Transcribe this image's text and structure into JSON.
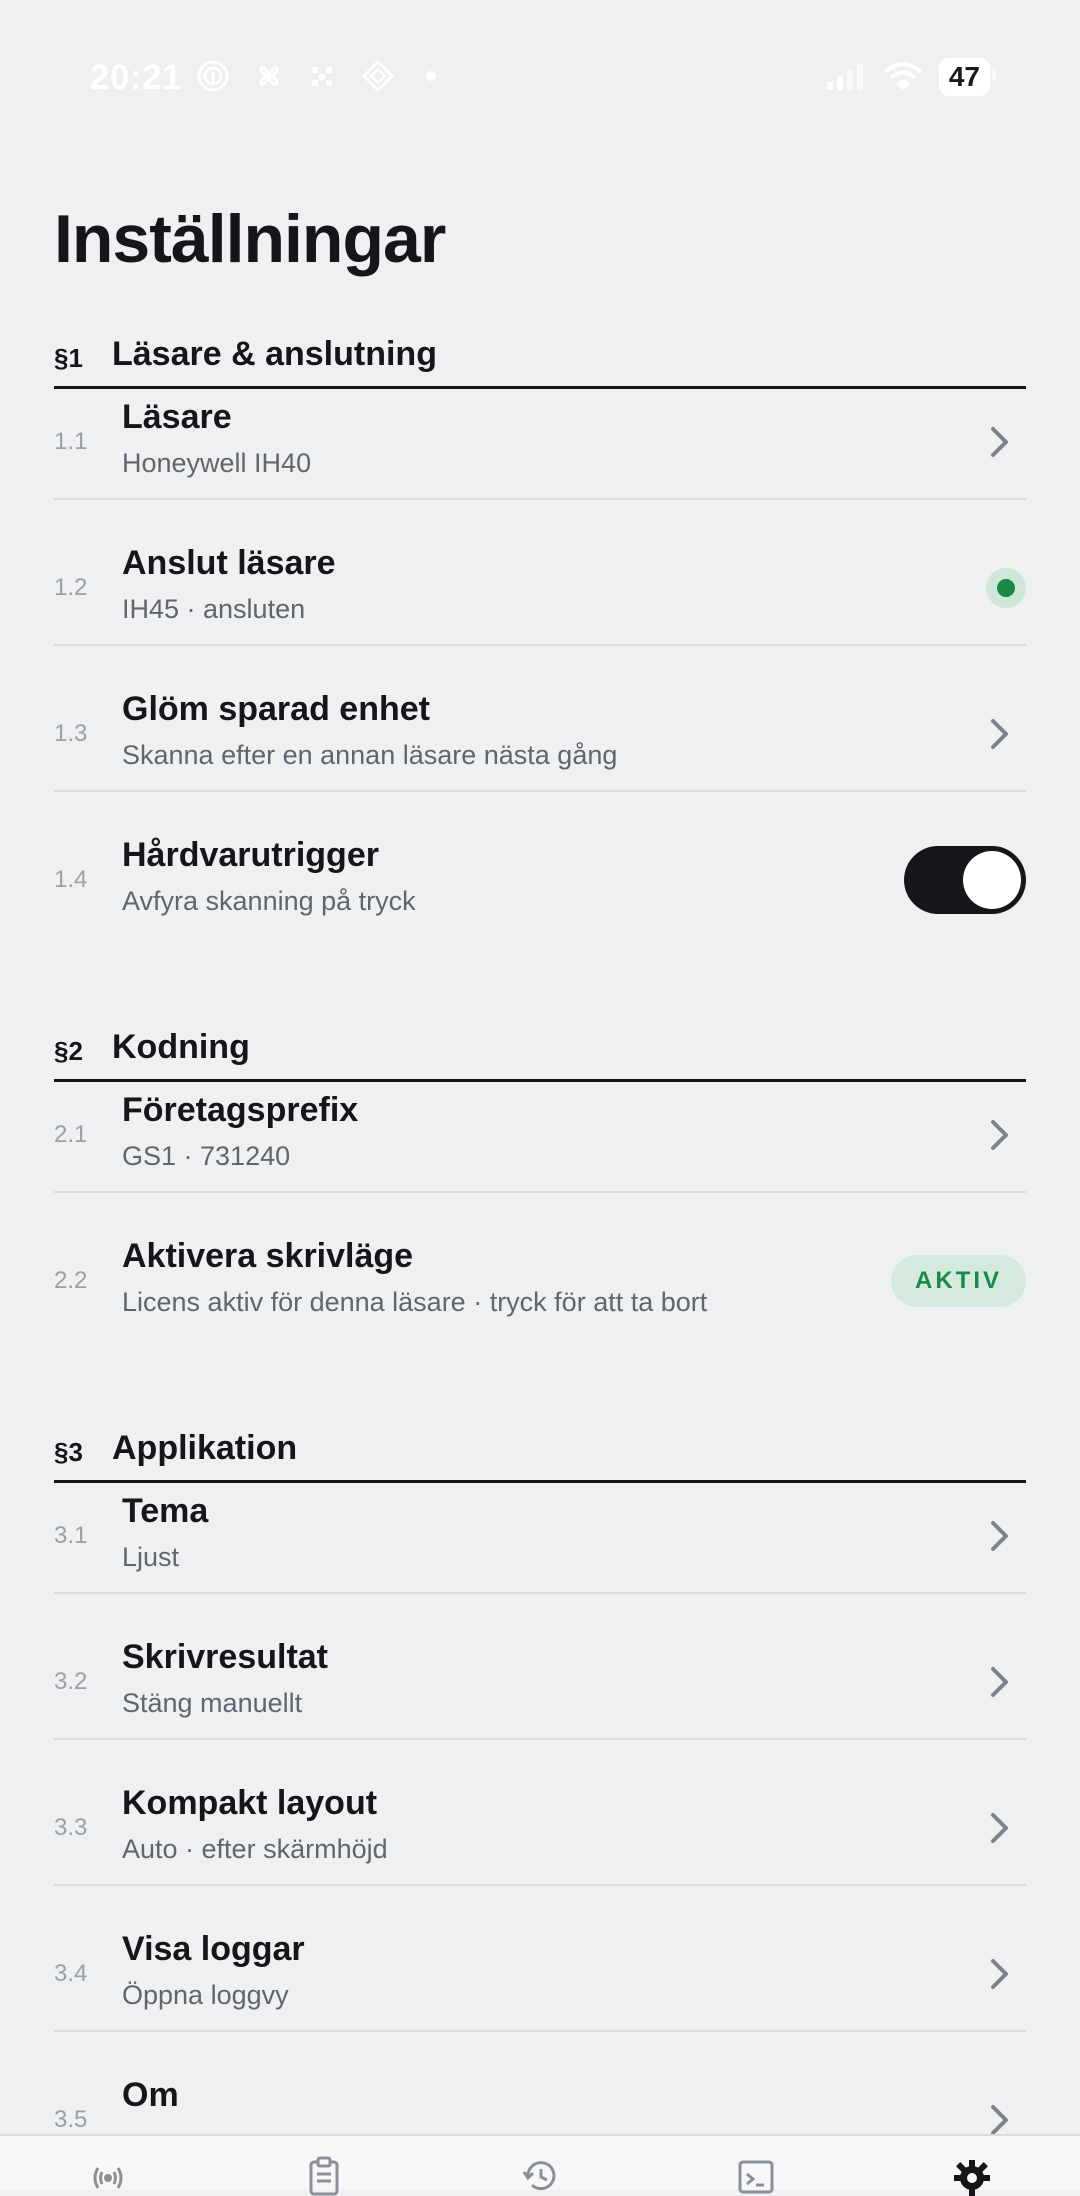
{
  "status_bar": {
    "time": "20:21",
    "battery": "47"
  },
  "page": {
    "title": "Inställningar"
  },
  "sections": [
    {
      "num": "§1",
      "title": "Läsare & anslutning",
      "rows": [
        {
          "idx": "1.1",
          "label": "Läsare",
          "sub": "Honeywell IH40",
          "control": "chevron"
        },
        {
          "idx": "1.2",
          "label": "Anslut läsare",
          "sub": "IH45 · ansluten",
          "control": "status-dot"
        },
        {
          "idx": "1.3",
          "label": "Glöm sparad enhet",
          "sub": "Skanna efter en annan läsare nästa gång",
          "control": "chevron"
        },
        {
          "idx": "1.4",
          "label": "Hårdvarutrigger",
          "sub": "Avfyra skanning på tryck",
          "control": "toggle",
          "toggle_on": true
        }
      ]
    },
    {
      "num": "§2",
      "title": "Kodning",
      "rows": [
        {
          "idx": "2.1",
          "label": "Företagsprefix",
          "sub": "GS1 · 731240",
          "control": "chevron"
        },
        {
          "idx": "2.2",
          "label": "Aktivera skrivläge",
          "sub": "Licens aktiv för denna läsare · tryck för att ta bort",
          "control": "badge",
          "badge": "AKTIV"
        }
      ]
    },
    {
      "num": "§3",
      "title": "Applikation",
      "rows": [
        {
          "idx": "3.1",
          "label": "Tema",
          "sub": "Ljust",
          "control": "chevron"
        },
        {
          "idx": "3.2",
          "label": "Skrivresultat",
          "sub": "Stäng manuellt",
          "control": "chevron"
        },
        {
          "idx": "3.3",
          "label": "Kompakt layout",
          "sub": "Auto · efter skärmhöjd",
          "control": "chevron"
        },
        {
          "idx": "3.4",
          "label": "Visa loggar",
          "sub": "Öppna loggvy",
          "control": "chevron"
        },
        {
          "idx": "3.5",
          "label": "Om",
          "sub": "",
          "control": "chevron"
        }
      ]
    }
  ],
  "tabbar": {
    "active": "settings",
    "tabs": [
      "scan-icon",
      "clipboard-icon",
      "history-icon",
      "terminal-icon",
      "gear-icon"
    ]
  },
  "colors": {
    "background": "#eff0f2",
    "ink": "#14161a",
    "accent_green": "#1a8a4a",
    "muted": "#5f6670"
  }
}
